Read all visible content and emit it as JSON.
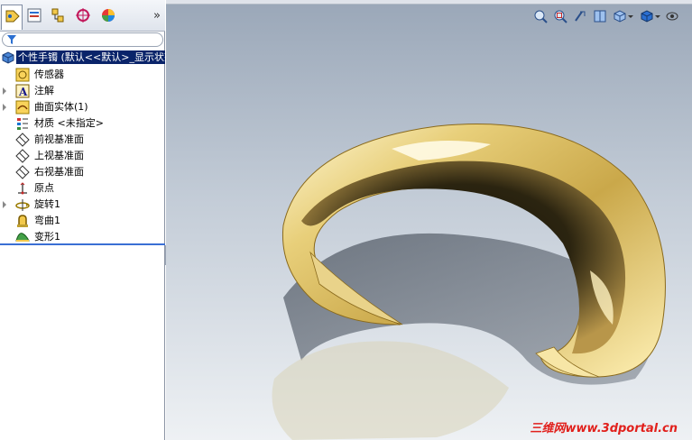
{
  "feature_tree": {
    "root_label": "个性手镯 (默认<<默认>_显示状态",
    "items": [
      {
        "label": "传感器",
        "icon": "sensor-icon",
        "expandable": false
      },
      {
        "label": "注解",
        "icon": "annotation-icon",
        "expandable": true
      },
      {
        "label": "曲面实体(1)",
        "icon": "surface-body-icon",
        "expandable": true
      },
      {
        "label": "材质 <未指定>",
        "icon": "material-icon",
        "expandable": false
      },
      {
        "label": "前视基准面",
        "icon": "plane-icon",
        "expandable": false
      },
      {
        "label": "上视基准面",
        "icon": "plane-icon",
        "expandable": false
      },
      {
        "label": "右视基准面",
        "icon": "plane-icon",
        "expandable": false
      },
      {
        "label": "原点",
        "icon": "origin-icon",
        "expandable": false
      },
      {
        "label": "旋转1",
        "icon": "revolve-icon",
        "expandable": true
      },
      {
        "label": "弯曲1",
        "icon": "flex-icon",
        "expandable": false
      },
      {
        "label": "变形1",
        "icon": "deform-icon",
        "expandable": false
      }
    ]
  },
  "tabs": [
    "feature-manager",
    "property-manager",
    "configuration-manager",
    "dim-xpert-manager",
    "display-manager"
  ],
  "more_chevron": "»",
  "viewport": {
    "toolbar_icons": [
      "zoom-to-fit-icon",
      "zoom-to-area-icon",
      "previous-view-icon",
      "section-view-icon",
      "view-orientation-icon",
      "display-style-icon",
      "hide-show-icon"
    ]
  },
  "watermark": "三维网www.3dportal.cn",
  "colors": {
    "selection": "#0a246a",
    "gold": "#d9bf6a",
    "watermark": "#e1201c"
  }
}
